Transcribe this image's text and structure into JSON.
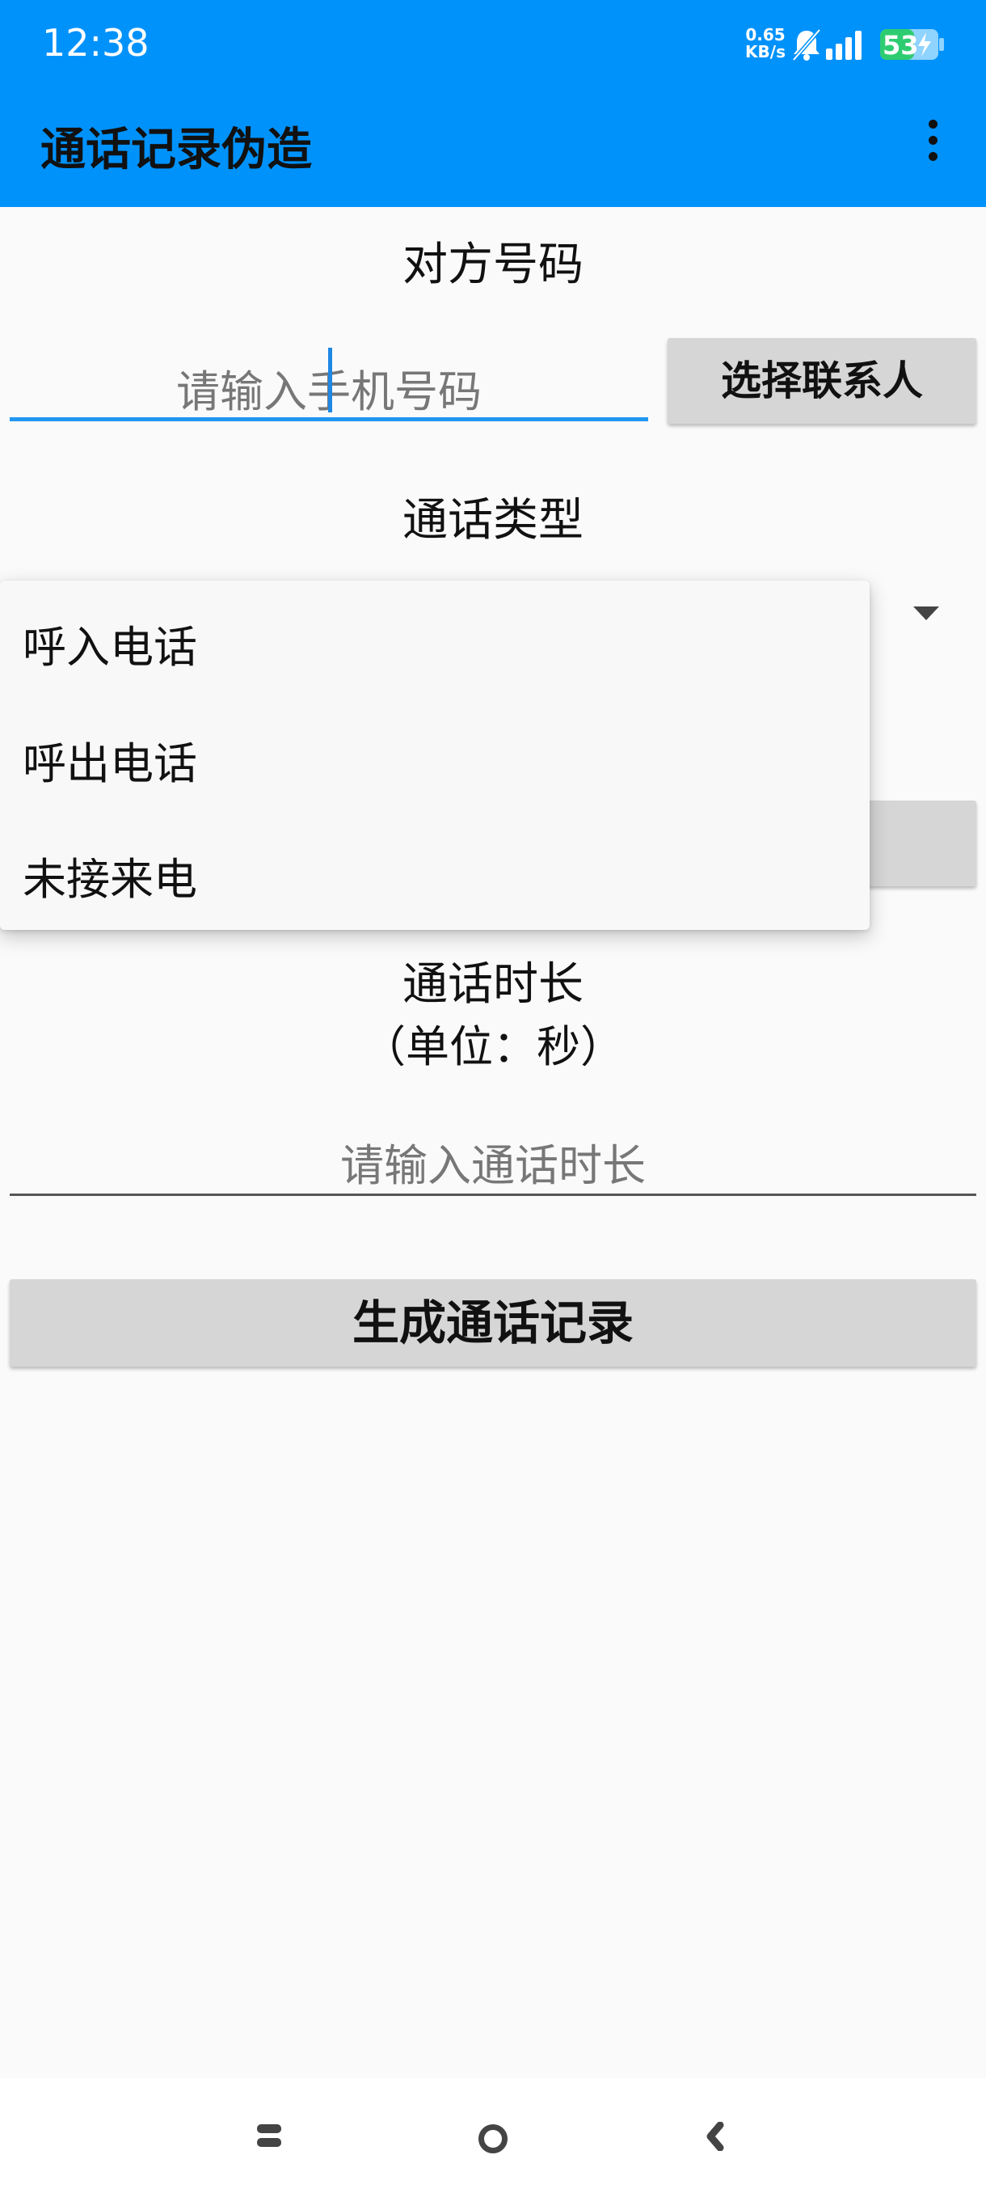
{
  "status_bar": {
    "time": "12:38",
    "net_speed_value": "0.65",
    "net_speed_unit": "KB/s",
    "battery": "53",
    "icons": [
      "bell-muted-icon",
      "signal-icon",
      "battery-charging-icon"
    ]
  },
  "app_bar": {
    "title": "通话记录伪造",
    "menu_icon": "more-vert-icon"
  },
  "form": {
    "phone_label": "对方号码",
    "phone_placeholder": "请输入手机号码",
    "select_contact_label": "选择联系人",
    "call_type_label": "通话类型",
    "call_type_options": [
      "呼入电话",
      "呼出电话",
      "未接来电"
    ],
    "duration_label": "通话时长",
    "duration_unit": "（单位：秒）",
    "duration_placeholder": "请输入通话时长",
    "generate_label": "生成通话记录"
  },
  "nav_bar": {
    "icons": [
      "menu-icon",
      "home-icon",
      "back-icon"
    ]
  },
  "colors": {
    "primary": "#0092fb",
    "accent": "#2196f3",
    "button_bg": "#d6d6d6",
    "battery": "#2ecc71"
  }
}
